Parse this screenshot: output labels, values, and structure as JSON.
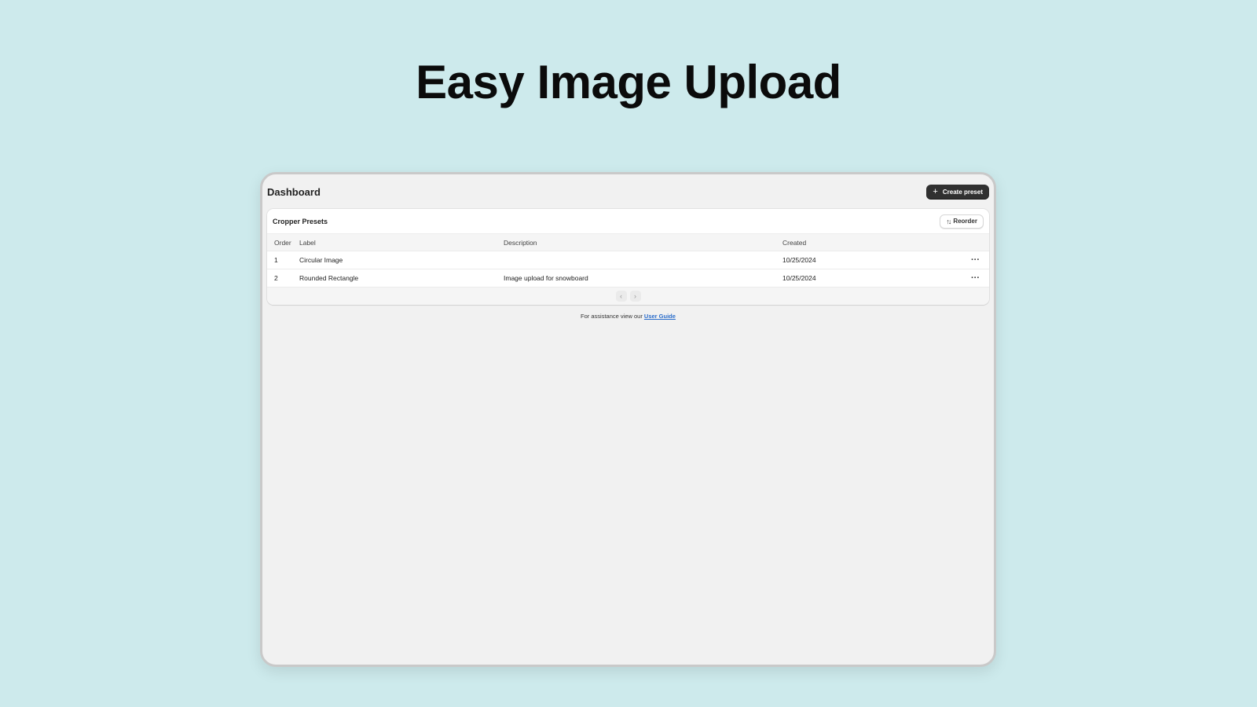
{
  "hero": {
    "title": "Easy Image Upload"
  },
  "header": {
    "title": "Dashboard",
    "create_button": {
      "label": "Create preset",
      "icon": "plus-icon"
    }
  },
  "card": {
    "title": "Cropper Presets",
    "reorder_button": {
      "label": "Reorder",
      "icon": "sort-arrows-icon"
    },
    "columns": [
      "Order",
      "Label",
      "Description",
      "Created"
    ],
    "rows": [
      {
        "order": "1",
        "label": "Circular Image",
        "description": "",
        "created": "10/25/2024",
        "actions_icon": "more-horizontal-icon"
      },
      {
        "order": "2",
        "label": "Rounded Rectangle",
        "description": "Image upload for snowboard",
        "created": "10/25/2024",
        "actions_icon": "more-horizontal-icon"
      }
    ],
    "pagination": {
      "prev_icon": "chevron-left-icon",
      "next_icon": "chevron-right-icon"
    }
  },
  "footer": {
    "text": "For assistance view our",
    "link_label": "User Guide"
  },
  "colors": {
    "background": "#cdeaec",
    "primary_button": "#303030",
    "link": "#2c6ecb"
  }
}
